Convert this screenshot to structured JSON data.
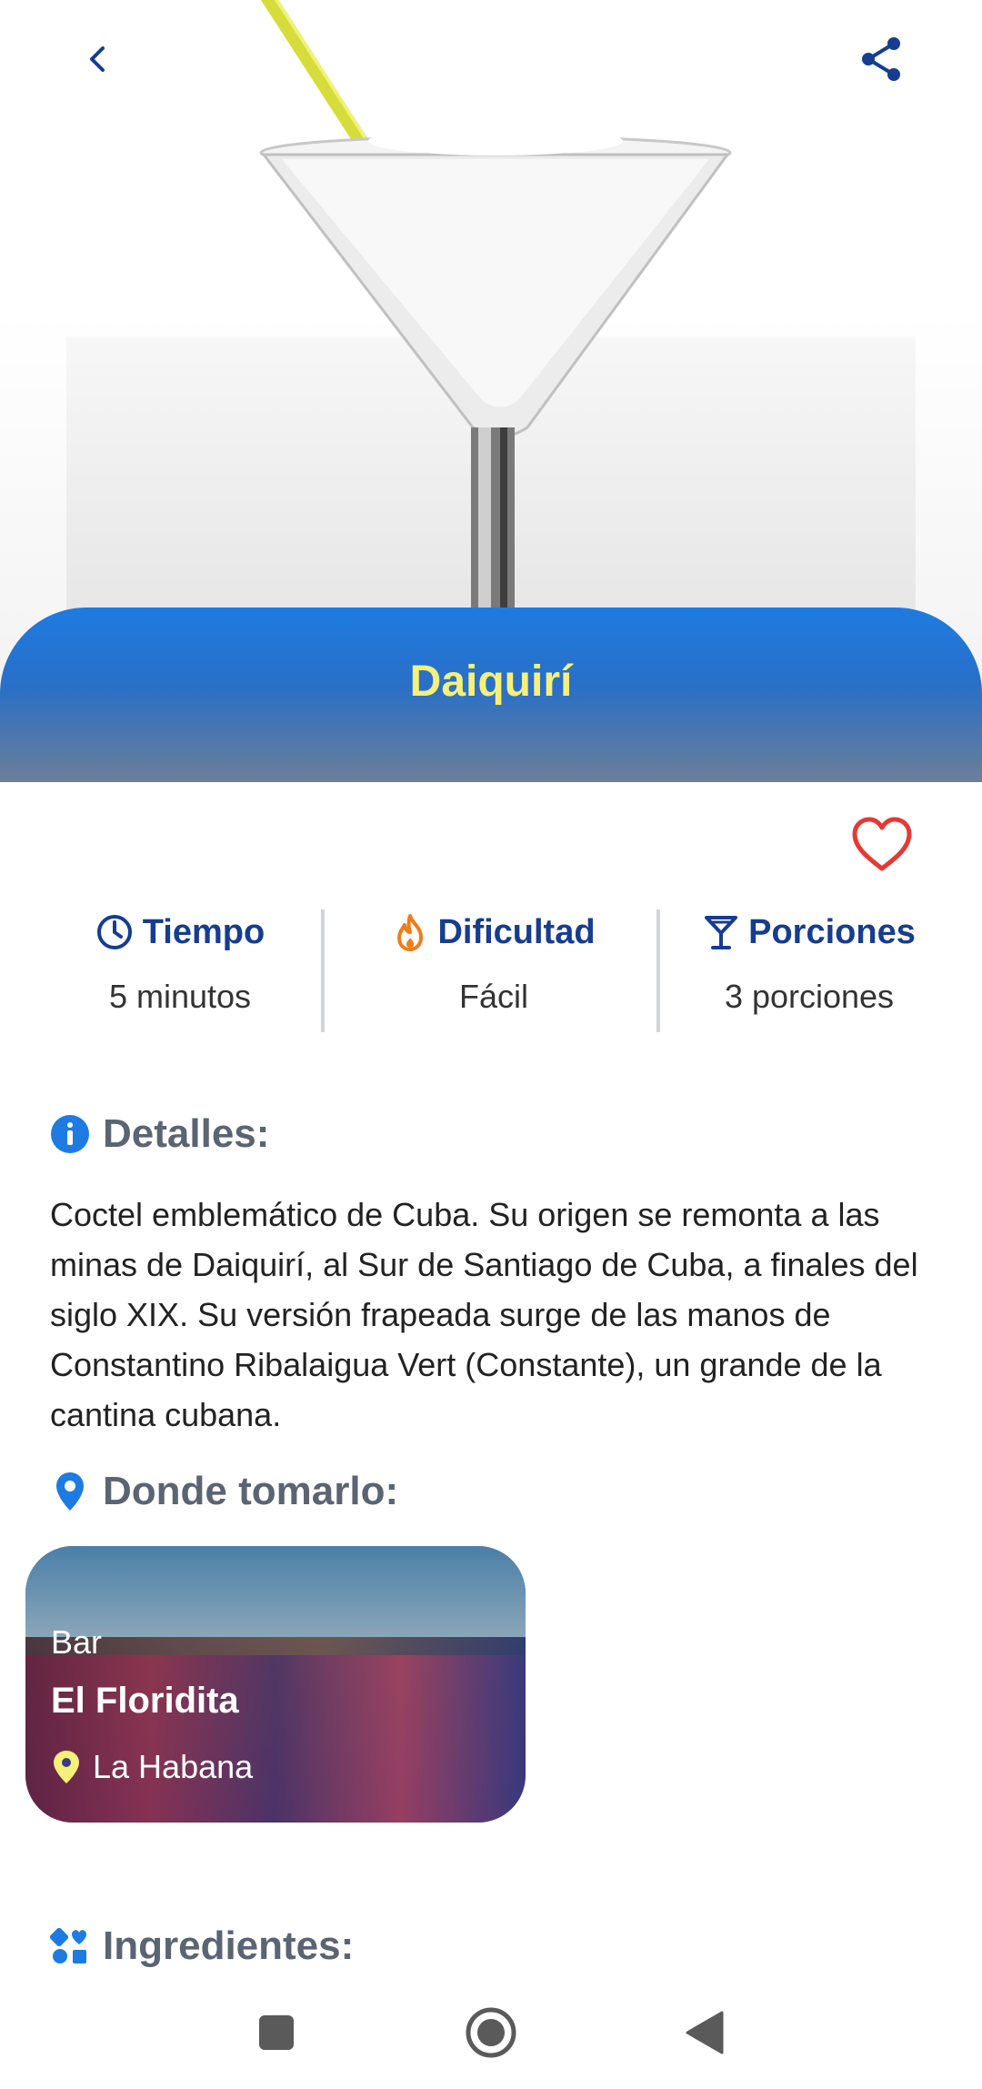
{
  "drink": {
    "name": "Daiquirí"
  },
  "stats": [
    {
      "label": "Tiempo",
      "value": "5 minutos"
    },
    {
      "label": "Dificultad",
      "value": "Fácil"
    },
    {
      "label": "Porciones",
      "value": "3 porciones"
    }
  ],
  "details": {
    "heading": "Detalles:",
    "text": "Coctel emblemático de Cuba. Su origen se remonta a las minas de Daiquirí, al Sur de Santiago de Cuba, a finales del siglo XIX. Su versión frapeada surge de las manos de Constantino Ribalaigua Vert (Constante), un grande de la cantina cubana."
  },
  "where": {
    "heading": "Donde tomarlo:",
    "place": {
      "type": "Bar",
      "name": "El Floridita",
      "city": "La Habana"
    }
  },
  "ingredients": {
    "heading": "Ingredientes:"
  },
  "colors": {
    "accent": "#1e7be1",
    "title": "#f5f07a",
    "heart": "#e53935",
    "stat_label": "#163d8f"
  },
  "icons": [
    "back-icon",
    "share-icon",
    "heart-icon",
    "clock-icon",
    "flame-icon",
    "cocktail-glass-icon",
    "info-icon",
    "location-pin-icon",
    "ingredients-icon"
  ]
}
